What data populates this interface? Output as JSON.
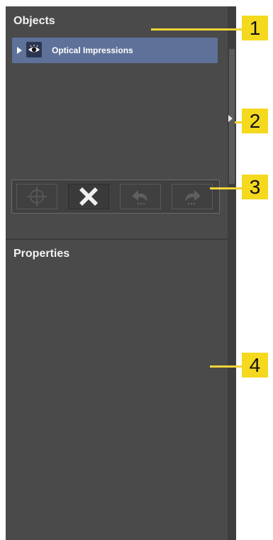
{
  "objects": {
    "title": "Objects",
    "items": [
      {
        "label": "Optical Impressions",
        "icon": "eye-icon",
        "selected": true
      }
    ]
  },
  "toolbar": {
    "buttons": [
      {
        "icon": "crosshair-icon",
        "enabled": false
      },
      {
        "icon": "delete-x-icon",
        "enabled": true
      },
      {
        "icon": "undo-icon",
        "enabled": false
      },
      {
        "icon": "redo-icon",
        "enabled": false
      }
    ]
  },
  "properties": {
    "title": "Properties"
  },
  "callouts": [
    "1",
    "2",
    "3",
    "4"
  ],
  "colors": {
    "panel": "#4a4a4a",
    "selection": "#5e7199",
    "callout": "#f5d91e"
  }
}
